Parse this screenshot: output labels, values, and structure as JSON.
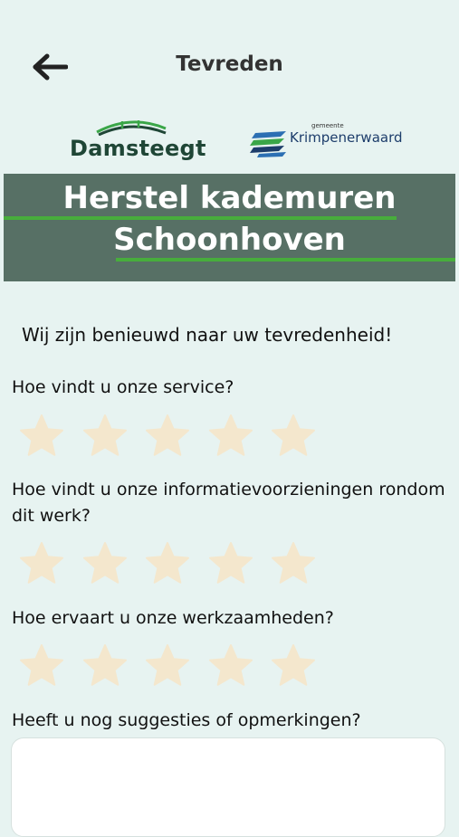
{
  "header": {
    "title": "Tevreden",
    "back_icon": "arrow-left-icon"
  },
  "logos": {
    "damsteegt": "Damsteegt",
    "krimpenerwaard_small": "gemeente",
    "krimpenerwaard": "Krimpenerwaard"
  },
  "banner": {
    "line1": "Herstel kademuren",
    "line2": "Schoonhoven",
    "accent_color": "#47ad3c",
    "bg_color": "#577065"
  },
  "intro": "Wij zijn benieuwd naar uw tevredenheid!",
  "questions": [
    {
      "text": "Hoe vindt u onze service?",
      "rating": 0,
      "max": 5
    },
    {
      "text": "Hoe vindt u onze informatievoorzieningen rondom dit werk?",
      "rating": 0,
      "max": 5
    },
    {
      "text": "Hoe ervaart u onze werkzaamheden?",
      "rating": 0,
      "max": 5
    }
  ],
  "suggestions": {
    "label": "Heeft u nog suggesties of opmerkingen?",
    "value": ""
  },
  "star_color": "#f4e7cd"
}
